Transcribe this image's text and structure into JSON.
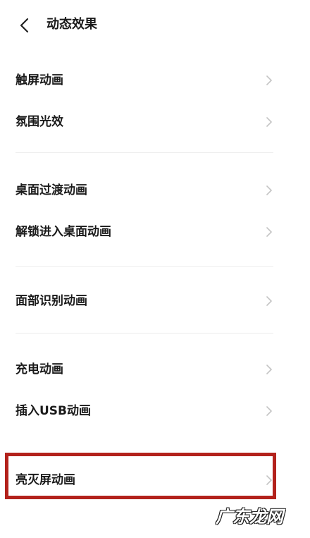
{
  "header": {
    "title": "动态效果",
    "back_icon": "chevron-left-icon"
  },
  "rows": [
    {
      "label": "触屏动画"
    },
    {
      "label": "氛围光效"
    },
    {
      "label": "桌面过渡动画"
    },
    {
      "label": "解锁进入桌面动画"
    },
    {
      "label": "面部识别动画"
    },
    {
      "label": "充电动画"
    },
    {
      "label": "插入USB动画"
    },
    {
      "label": "亮灭屏动画"
    }
  ],
  "chevron_icon": "chevron-right-icon",
  "watermark": "广东龙网",
  "colors": {
    "highlight": "#b3221c",
    "chevron": "#c4c4c4",
    "text": "#1a1a1a"
  }
}
